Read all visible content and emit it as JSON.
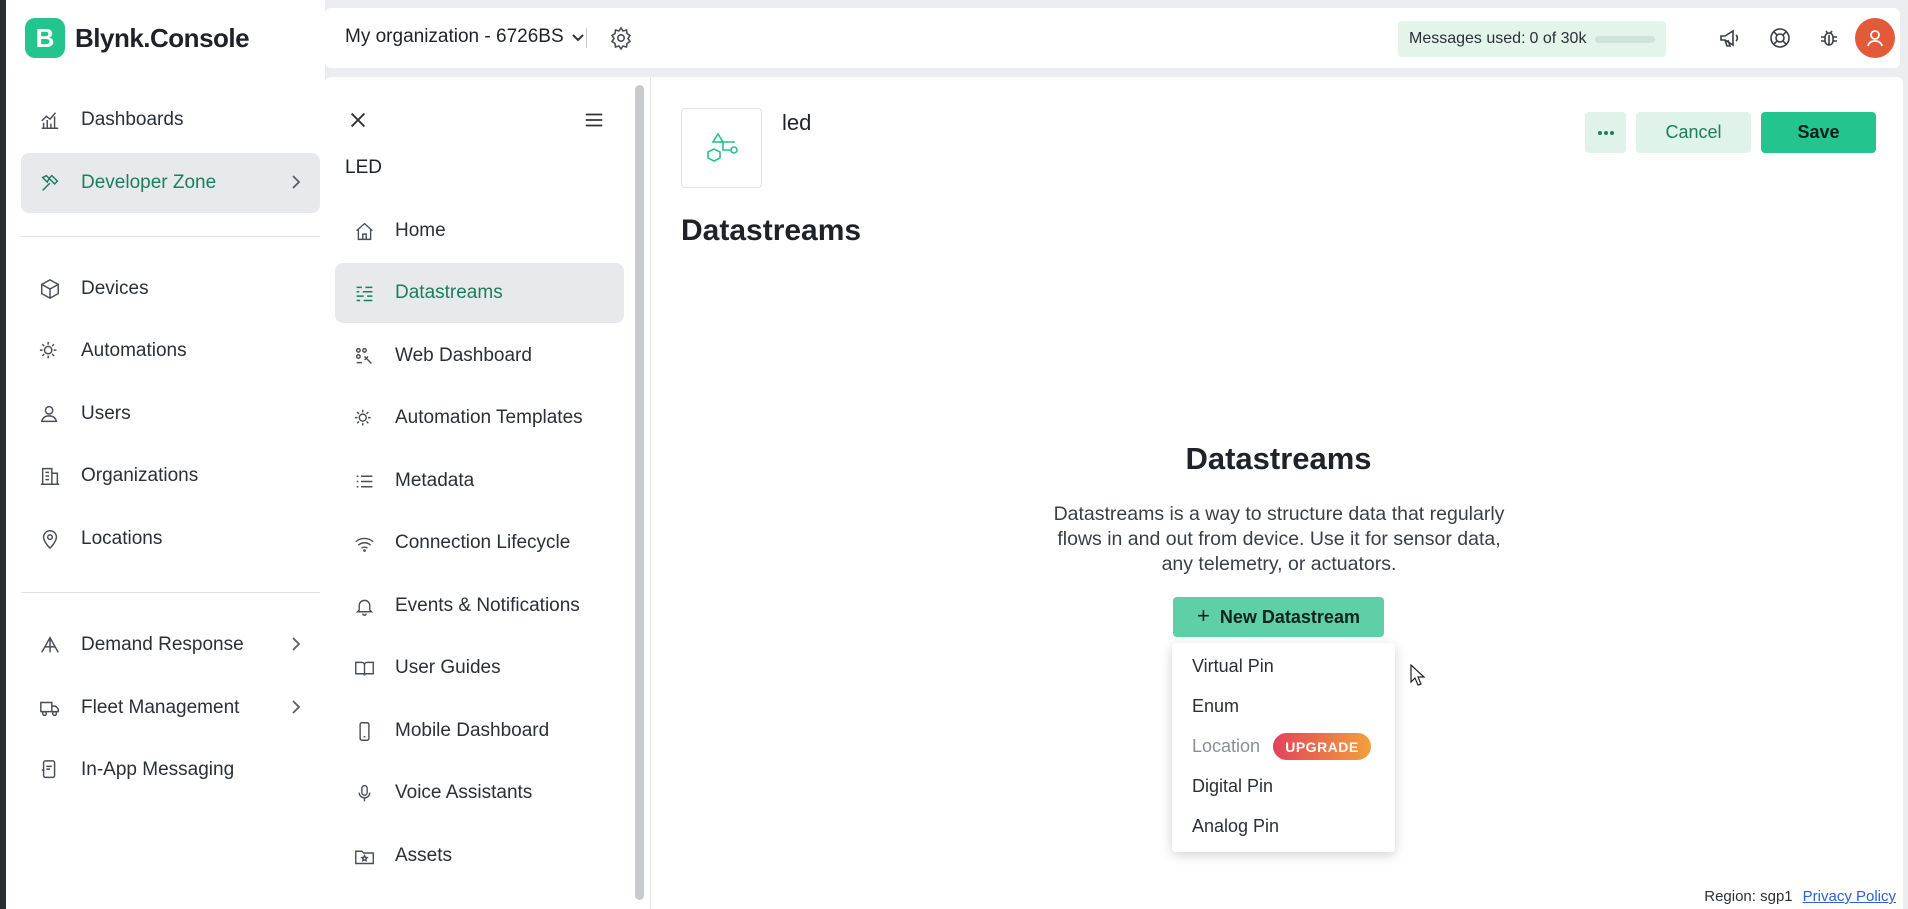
{
  "app": {
    "logo_letter": "B",
    "name": "Blynk.Console",
    "brand_color": "#23c48e"
  },
  "sidebar": {
    "items": [
      {
        "label": "Dashboards",
        "icon": "dashboard-icon"
      },
      {
        "label": "Developer Zone",
        "icon": "tools-icon",
        "active": true,
        "has_chevron": true
      },
      {
        "label": "Devices",
        "icon": "cube-icon"
      },
      {
        "label": "Automations",
        "icon": "automation-icon"
      },
      {
        "label": "Users",
        "icon": "user-icon"
      },
      {
        "label": "Organizations",
        "icon": "building-icon"
      },
      {
        "label": "Locations",
        "icon": "location-pin-icon"
      },
      {
        "label": "Demand Response",
        "icon": "demand-response-icon",
        "has_chevron": true
      },
      {
        "label": "Fleet Management",
        "icon": "truck-icon",
        "has_chevron": true
      },
      {
        "label": "In-App Messaging",
        "icon": "messaging-icon"
      }
    ]
  },
  "topbar": {
    "org_name": "My organization - 6726BS",
    "messages_label": "Messages used:",
    "messages_value": "0 of 30k",
    "messages_used_fraction": 0.0,
    "icons": [
      "announcement-icon",
      "help-lifebuoy-icon",
      "bug-icon",
      "avatar"
    ]
  },
  "template": {
    "name": "LED",
    "nav": [
      {
        "label": "Home",
        "icon": "home-icon"
      },
      {
        "label": "Datastreams",
        "icon": "datastreams-icon",
        "active": true
      },
      {
        "label": "Web Dashboard",
        "icon": "web-dashboard-icon"
      },
      {
        "label": "Automation Templates",
        "icon": "automation-icon"
      },
      {
        "label": "Metadata",
        "icon": "list-icon"
      },
      {
        "label": "Connection Lifecycle",
        "icon": "wifi-icon"
      },
      {
        "label": "Events & Notifications",
        "icon": "bell-icon"
      },
      {
        "label": "User Guides",
        "icon": "book-icon"
      },
      {
        "label": "Mobile Dashboard",
        "icon": "mobile-icon"
      },
      {
        "label": "Voice Assistants",
        "icon": "microphone-icon"
      },
      {
        "label": "Assets",
        "icon": "folder-star-icon"
      }
    ]
  },
  "main": {
    "title": "led",
    "cancel_label": "Cancel",
    "save_label": "Save",
    "page_title": "Datastreams",
    "empty_title": "Datastreams",
    "empty_desc": "Datastreams is a way to structure data that regularly flows in and out from device. Use it for sensor data, any telemetry, or actuators.",
    "new_button_label": "New Datastream",
    "dropdown": [
      {
        "label": "Virtual Pin"
      },
      {
        "label": "Enum"
      },
      {
        "label": "Location",
        "disabled": true,
        "badge": "UPGRADE"
      },
      {
        "label": "Digital Pin"
      },
      {
        "label": "Analog Pin"
      }
    ]
  },
  "footer": {
    "region": "Region: sgp1",
    "privacy": "Privacy Policy"
  }
}
